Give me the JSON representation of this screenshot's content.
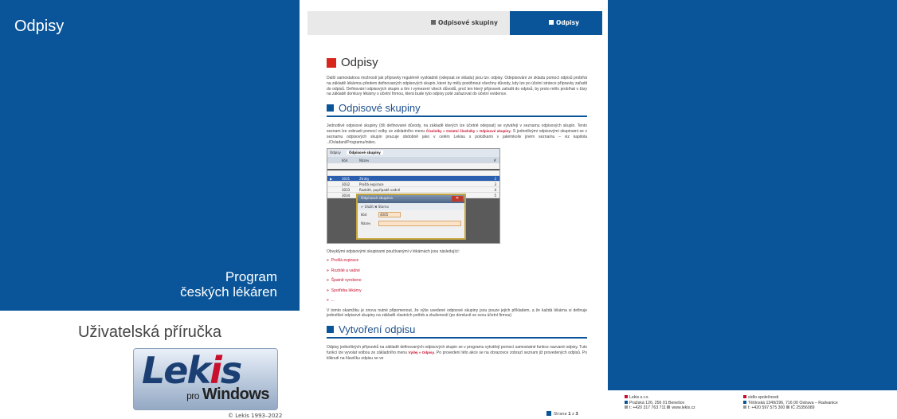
{
  "left": {
    "title": "Odpisy",
    "subtitle_line1": "Program",
    "subtitle_line2": "českých lékáren",
    "guide_title": "Uživatelská příručka",
    "logo_main_a": "Lek",
    "logo_main_b": "i",
    "logo_main_c": "s",
    "logo_pro": "pro",
    "logo_windows": "Windows",
    "copyright": "© Lekis 1993–2022"
  },
  "tabs": {
    "tab1": "Odpisové skupiny",
    "tab2": "Odpisy"
  },
  "doc": {
    "h1": "Odpisy",
    "p1": "Další samostatnou možností jak přípravky regulérně vyskladnit (odepsat ze skladu) jsou tzv. odpisy. Odepisování ze skladu pomocí odpisů probíhá na základě lékárnou předem definovaných odpisových skupin, které by měly postihnout všechny důvody, kdy lze po účetní stránce přípravky zařadit do odpisů. Definování odpisových skupin a tím i vymezení všech důvodů, proč ten který přípravek zařadit do odpisů, by proto mělo probíhat v žáry na základě domluvy lékárny s účetní firmou, která bude tyto odpisy poté zařazovat do účetní evidence.",
    "h2a": "Odpisové skupiny",
    "p2_pre": "Jednotlivé odpisové skupiny (čili definované důvody, na základě kterých lze účetně odepsat) se vytvářejí v seznamu odpisových skupin. Tento seznam lze zobrazit pomocí volby ze základního menu ",
    "p2_menu": "Číselníky » Ostatní číselníky » Odpisové skupiny",
    "p2_post": ". S jednotlivými odpisovými skupinami se v seznamu odpisových skupin pracuje obdobně jako v celém Lekisu s položkami v jakémkoliv jiném seznamu – viz kapitola ../Ovladani/Programu/index.",
    "p3": "Obvyklými odpisovými skupinami používanými v lékárnách jsou následující:",
    "bullets": [
      "Prošlá expirace",
      "Rozbité a vadné",
      "Špatně vyrobeno",
      "Spotřeba lékárny",
      "..."
    ],
    "p4": "V tomto okamžiku je znovu nutné připomenout, že výše uvedené odpisové skupiny jsou pouze jejich příkladem, a že každá lékárna si definuje jednotlivé odpisové skupiny na základě vlastních potřeb a zkušeností (po domluvě se svou účetní firmou)",
    "h2b": "Vytvoření odpisu",
    "p5_pre": "Odpisy jednotlivých přípravků na základě definovaných odpisových skupin se v programu vytvářejí pomocí samostatné funkce nazvané odpisy. Tuto funkci lze vyvolat volbou ze základního menu ",
    "p5_menu": "Výdej » Odpisy",
    "p5_post": ". Po provedení této akce se na obrazovce zobrazí seznam již provedených odpisů. Po kliknutí na hlavičku odpisu se ve"
  },
  "shot": {
    "tab1": "Odpisy",
    "tab2": "Odpisové skupiny",
    "col1": "Kód",
    "col2": "Název",
    "col3": "#",
    "rows": [
      {
        "code": "",
        "name": "",
        "n": ""
      },
      {
        "code": "3031",
        "name": "Ztráty",
        "n": "2"
      },
      {
        "code": "3032",
        "name": "Prošlá expirace",
        "n": "3"
      },
      {
        "code": "3033",
        "name": "Rozbité, popřípadě vadné",
        "n": "4"
      },
      {
        "code": "3034",
        "name": "Vzhledy",
        "n": "5"
      }
    ],
    "dlg_title": "Odpisová skupina",
    "dlg_tool": "✔ Uložit   ✖ Storno",
    "dlg_code_label": "Kód",
    "dlg_code_value": "4005",
    "dlg_name_label": "Název"
  },
  "page_num": {
    "label": "Strana",
    "current": "1",
    "sep": "z",
    "total": "3"
  },
  "footer": {
    "company": "Lekis s.r.o.",
    "address": "Pražská 126, 256 01 Benešov",
    "phone": "t: +420 317 763 711",
    "web": "www.lekis.cz",
    "seat_label": "sídlo společnosti",
    "seat_address": "Těšínská 1349/296, 716 00 Ostrava – Radvanice",
    "seat_phone": "t: +420 597 575 300",
    "ico": "IČ 25356089"
  },
  "colors": {
    "brand_blue": "#0a5599",
    "accent_red": "#c8102e"
  }
}
